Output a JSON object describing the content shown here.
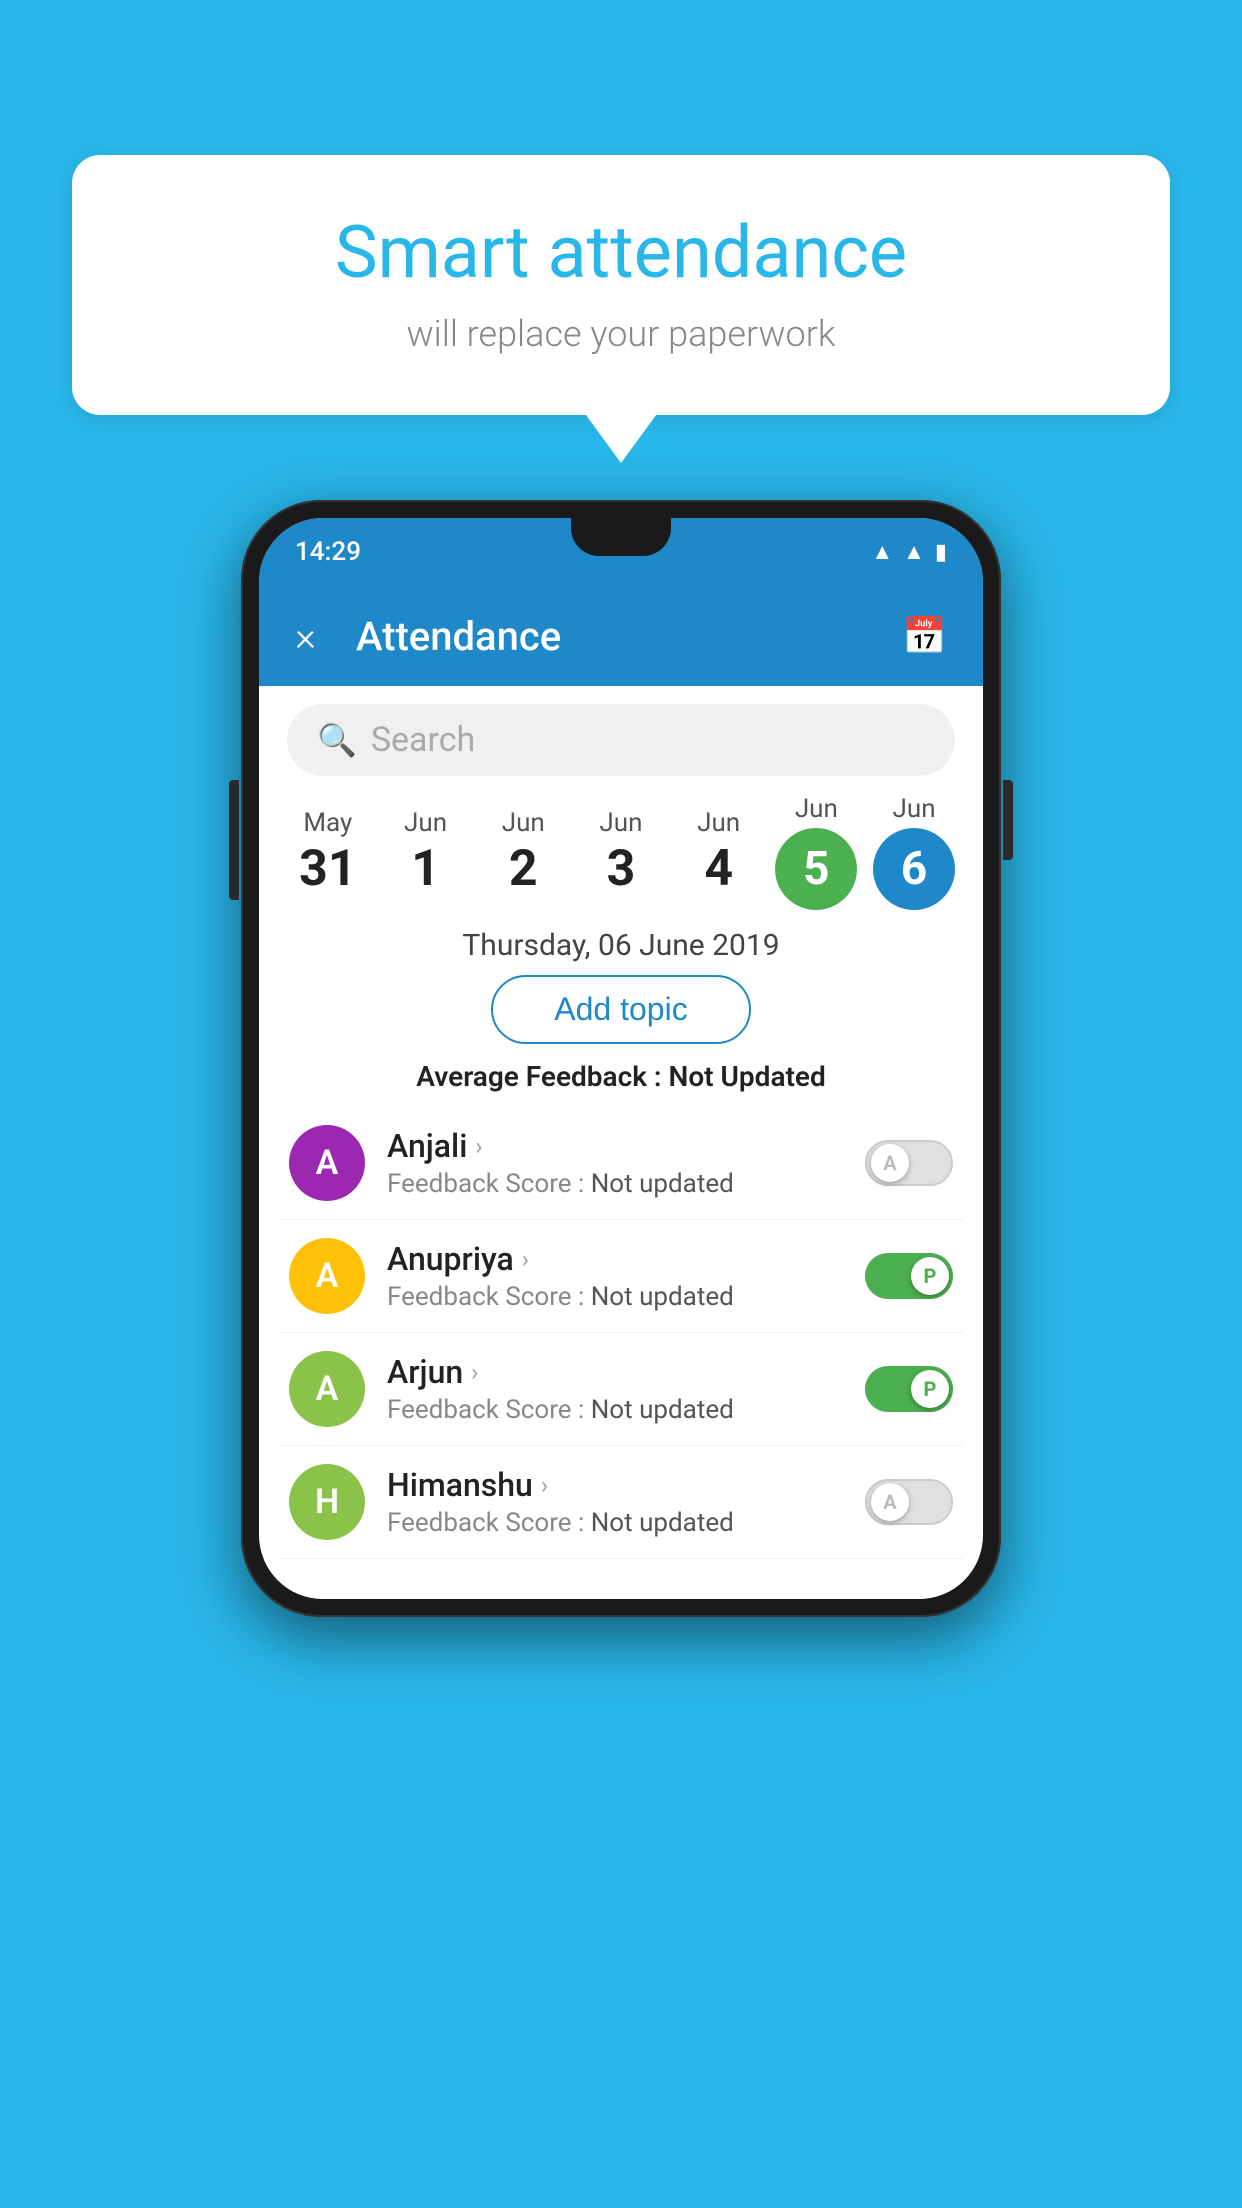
{
  "background_color": "#29b6e8",
  "bubble": {
    "title": "Smart attendance",
    "subtitle": "will replace your paperwork"
  },
  "phone": {
    "status_bar": {
      "time": "14:29",
      "wifi_icon": "wifi",
      "signal_icon": "signal",
      "battery_icon": "battery"
    },
    "app_bar": {
      "close_label": "×",
      "title": "Attendance",
      "calendar_icon": "calendar"
    },
    "search": {
      "placeholder": "Search"
    },
    "calendar": {
      "days": [
        {
          "month": "May",
          "date": "31",
          "type": "normal"
        },
        {
          "month": "Jun",
          "date": "1",
          "type": "normal"
        },
        {
          "month": "Jun",
          "date": "2",
          "type": "normal"
        },
        {
          "month": "Jun",
          "date": "3",
          "type": "normal"
        },
        {
          "month": "Jun",
          "date": "4",
          "type": "normal"
        },
        {
          "month": "Jun",
          "date": "5",
          "type": "green"
        },
        {
          "month": "Jun",
          "date": "6",
          "type": "blue"
        }
      ]
    },
    "selected_date": "Thursday, 06 June 2019",
    "add_topic_label": "Add topic",
    "avg_feedback_label": "Average Feedback :",
    "avg_feedback_value": "Not Updated",
    "students": [
      {
        "name": "Anjali",
        "avatar_letter": "A",
        "avatar_color": "purple",
        "feedback_label": "Feedback Score :",
        "feedback_value": "Not updated",
        "toggle_state": "off",
        "toggle_letter": "A"
      },
      {
        "name": "Anupriya",
        "avatar_letter": "A",
        "avatar_color": "yellow",
        "feedback_label": "Feedback Score :",
        "feedback_value": "Not updated",
        "toggle_state": "on",
        "toggle_letter": "P"
      },
      {
        "name": "Arjun",
        "avatar_letter": "A",
        "avatar_color": "green-light",
        "feedback_label": "Feedback Score :",
        "feedback_value": "Not updated",
        "toggle_state": "on",
        "toggle_letter": "P"
      },
      {
        "name": "Himanshu",
        "avatar_letter": "H",
        "avatar_color": "green-light",
        "feedback_label": "Feedback Score :",
        "feedback_value": "Not updated",
        "toggle_state": "off",
        "toggle_letter": "A"
      }
    ]
  }
}
